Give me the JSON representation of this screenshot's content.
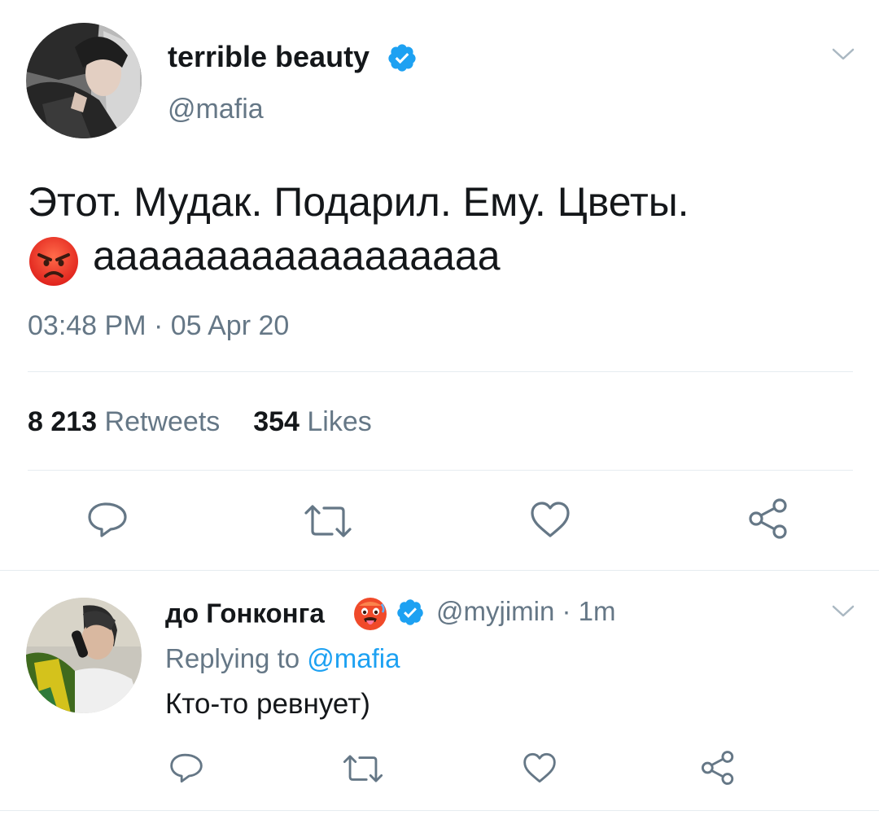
{
  "tweet": {
    "author_name": "terrible beauty",
    "author_handle": "@mafia",
    "text_line1": "Этот. Мудак. Подарил. Ему. Цветы.",
    "text_line2": "aaaaaaaaaaaaaaaaaa",
    "timestamp": "03:48 PM · 05 Apr 20",
    "retweets_count": "8 213",
    "retweets_label": "Retweets",
    "likes_count": "354",
    "likes_label": "Likes"
  },
  "reply": {
    "author_name": "до Гонконга",
    "author_handle": "@myjimin",
    "time": "· 1m",
    "replying_prefix": "Replying to",
    "replying_handle": "@mafia",
    "text": "Кто-то ревнует)"
  },
  "colors": {
    "accent": "#1da1f2",
    "muted": "#657786",
    "divider": "#e6ecf0",
    "icon": "#657786"
  },
  "icons": {
    "caret": "chevron-down-icon",
    "verified": "verified-badge-icon",
    "angry": "angry-face-emoji",
    "hot": "hot-face-emoji",
    "reply": "reply-icon",
    "retweet": "retweet-icon",
    "like": "heart-icon",
    "share": "share-icon"
  }
}
